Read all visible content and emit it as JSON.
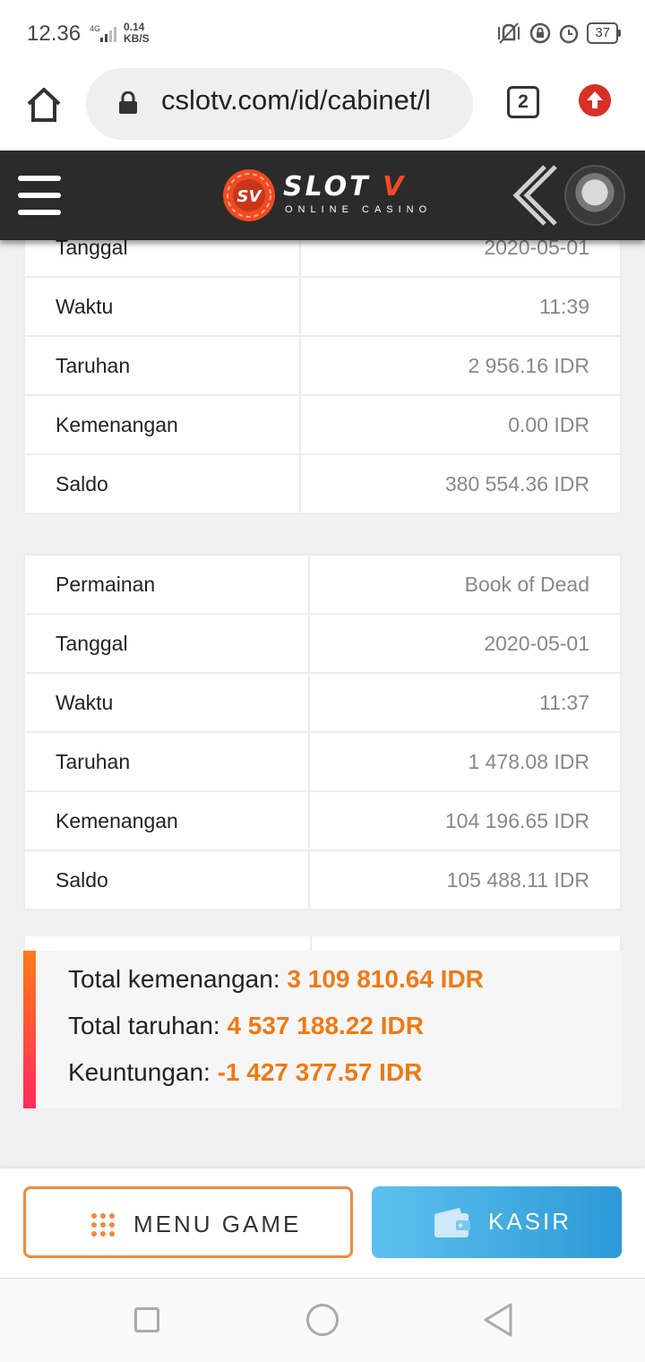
{
  "status_bar": {
    "time": "12.36",
    "network_type": "4G",
    "speed_value": "0.14",
    "speed_unit": "KB/S",
    "battery": "37"
  },
  "browser": {
    "url": "cslotv.com/id/cabinet/l",
    "tab_count": "2"
  },
  "site_header": {
    "logo_badge": "SV",
    "logo_word": "SLOT",
    "logo_word_accent": "V",
    "logo_subtitle": "ONLINE CASINO"
  },
  "transactions": [
    {
      "rows": [
        {
          "label": "Tanggal",
          "value": "2020-05-01"
        },
        {
          "label": "Waktu",
          "value": "11:39"
        },
        {
          "label": "Taruhan",
          "value": "2 956.16 IDR"
        },
        {
          "label": "Kemenangan",
          "value": "0.00 IDR"
        },
        {
          "label": "Saldo",
          "value": "380 554.36 IDR"
        }
      ]
    },
    {
      "rows": [
        {
          "label": "Permainan",
          "value": "Book of Dead"
        },
        {
          "label": "Tanggal",
          "value": "2020-05-01"
        },
        {
          "label": "Waktu",
          "value": "11:37"
        },
        {
          "label": "Taruhan",
          "value": "1 478.08 IDR"
        },
        {
          "label": "Kemenangan",
          "value": "104 196.65 IDR"
        },
        {
          "label": "Saldo",
          "value": "105 488.11 IDR"
        }
      ]
    }
  ],
  "totals": {
    "win_label": "Total kemenangan:",
    "win_value": "3 109 810.64 IDR",
    "bet_label": "Total taruhan:",
    "bet_value": "4 537 188.22 IDR",
    "profit_label": "Keuntungan:",
    "profit_value": "-1 427 377.57 IDR"
  },
  "actions": {
    "menu_game": "MENU GAME",
    "kasir": "KASIR"
  },
  "colors": {
    "accent_orange": "#ee7a16",
    "header_bg": "#2b2b2b",
    "kasir_blue": "#2b9ad6"
  }
}
